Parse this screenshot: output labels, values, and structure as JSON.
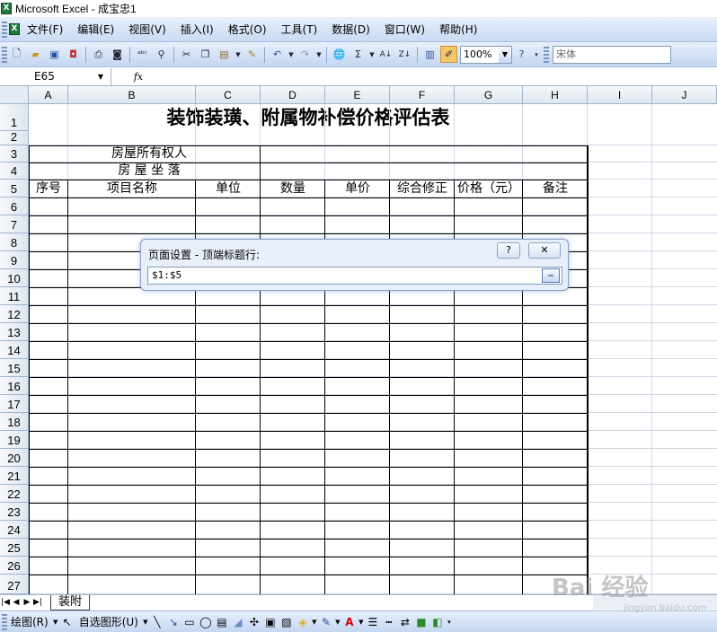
{
  "window": {
    "title": "Microsoft Excel - 成宝忠1",
    "app_icon": "excel-icon"
  },
  "menu": {
    "items": [
      "文件(F)",
      "编辑(E)",
      "视图(V)",
      "插入(I)",
      "格式(O)",
      "工具(T)",
      "数据(D)",
      "窗口(W)",
      "帮助(H)"
    ]
  },
  "toolbar": {
    "zoom": "100%",
    "font_name": "宋体",
    "icons": [
      "new-icon",
      "open-icon",
      "save-icon",
      "permission-icon",
      "print-icon",
      "print-preview-icon",
      "spelling-icon",
      "research-icon",
      "cut-icon",
      "copy-icon",
      "paste-icon",
      "format-painter-icon",
      "undo-icon",
      "redo-icon",
      "hyperlink-icon",
      "autosum-icon",
      "sort-ascending-icon",
      "sort-descending-icon",
      "chart-wizard-icon",
      "drawing-icon",
      "help-icon"
    ]
  },
  "formula_bar": {
    "cell_ref": "E65",
    "fx_label": "fx",
    "content": ""
  },
  "columns": [
    "A",
    "B",
    "C",
    "D",
    "E",
    "F",
    "G",
    "H",
    "I",
    "J"
  ],
  "rows": [
    "1",
    "2",
    "3",
    "4",
    "5",
    "6",
    "7",
    "8",
    "9",
    "10",
    "11",
    "12",
    "13",
    "14",
    "15",
    "16",
    "17",
    "18",
    "19",
    "20",
    "21",
    "22",
    "23",
    "24",
    "25",
    "26",
    "27"
  ],
  "sheet": {
    "title": "装饰装璜、附属物补偿价格评估表",
    "owner_label": "房屋所有权人",
    "location_label": "房 屋 坐 落",
    "headers": [
      "序号",
      "项目名称",
      "单位",
      "数量",
      "单价",
      "综合修正",
      "价格（元）",
      "备注"
    ]
  },
  "dialog": {
    "title": "页面设置 - 顶端标题行:",
    "help_label": "?",
    "close_label": "✕",
    "value": "$1:$5"
  },
  "tabs": {
    "active": "装附"
  },
  "drawing_bar": {
    "draw_label": "绘图(R)",
    "autoshapes_label": "自选图形(U)"
  },
  "watermark": {
    "text": "Bai 经验",
    "url": "jingyan.baidu.com"
  }
}
